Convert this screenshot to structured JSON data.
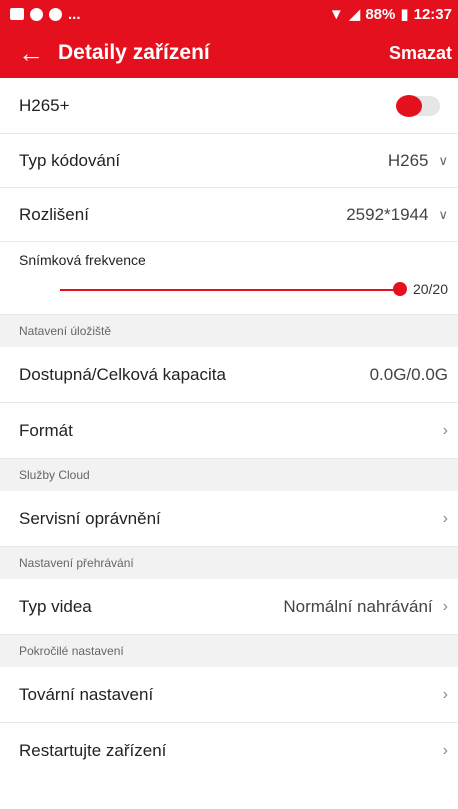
{
  "status_bar": {
    "left_dots": "...",
    "battery": "88%",
    "time": "12:37"
  },
  "app_bar": {
    "title": "Detaily zařízení",
    "delete_label": "Smazat"
  },
  "h265plus": {
    "label": "H265+",
    "enabled": true
  },
  "encoding": {
    "label": "Typ kódování",
    "value": "H265"
  },
  "resolution": {
    "label": "Rozlišení",
    "value": "2592*1944"
  },
  "frame_rate": {
    "label": "Snímková frekvence",
    "value": "20/20",
    "level": 1.0
  },
  "storage_section": {
    "header": "Natavení úložiště",
    "capacity_label": "Dostupná/Celková kapacita",
    "capacity_value": "0.0G/0.0G",
    "format_label": "Formát"
  },
  "cloud_section": {
    "header": "Služby Cloud",
    "service_label": "Servisní oprávnění"
  },
  "playback_section": {
    "header": "Nastavení přehrávání",
    "video_type_label": "Typ videa",
    "video_type_value": "Normální nahrávání"
  },
  "advanced_section": {
    "header": "Pokročilé nastavení",
    "factory_label": "Tovární nastavení",
    "restart_label": "Restartujte zařízení"
  },
  "colors": {
    "accent": "#e5101d"
  }
}
